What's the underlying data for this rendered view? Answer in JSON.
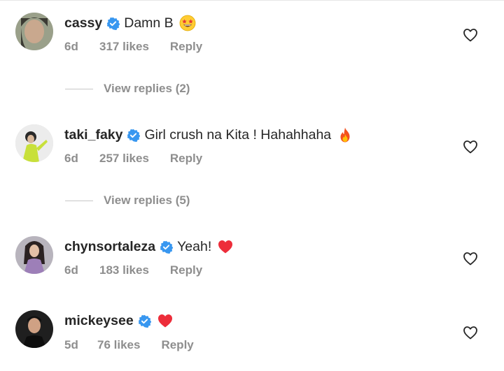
{
  "colors": {
    "text": "#262626",
    "muted": "#8e8e8e",
    "verified": "#3897f0",
    "heart_red": "#ed4956"
  },
  "comments": [
    {
      "username": "cassy",
      "text": "Damn B",
      "emoji": "star-struck-emoji",
      "time": "6d",
      "likes": "317 likes",
      "reply": "Reply",
      "view_replies": "View replies (2)"
    },
    {
      "username": "taki_faky",
      "text": "Girl crush na Kita ! Hahahhaha",
      "emoji": "fire-emoji",
      "time": "6d",
      "likes": "257 likes",
      "reply": "Reply",
      "view_replies": "View replies (5)"
    },
    {
      "username": "chynsortaleza",
      "text": "Yeah!",
      "emoji": "red-heart-emoji",
      "time": "6d",
      "likes": "183 likes",
      "reply": "Reply"
    },
    {
      "username": "mickeysee",
      "text": "",
      "emoji": "red-heart-emoji",
      "time": "5d",
      "likes": "76 likes",
      "reply": "Reply"
    }
  ]
}
